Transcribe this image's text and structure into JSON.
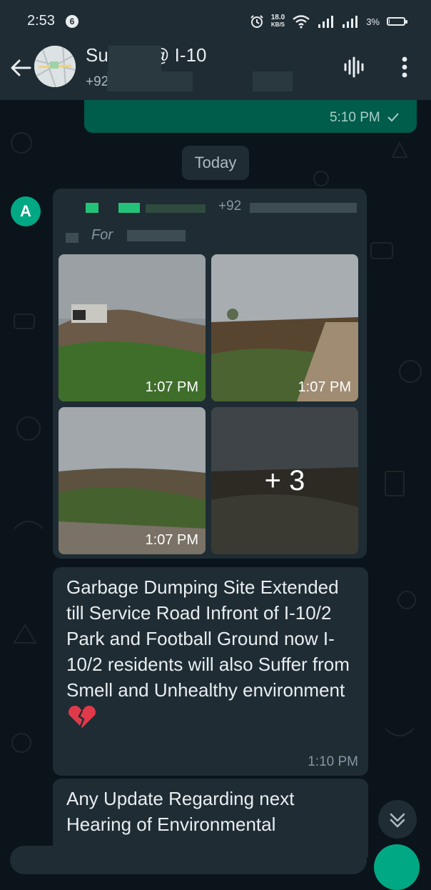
{
  "status_bar": {
    "time": "2:53",
    "notification_count": "6",
    "net_speed_value": "18.0",
    "net_speed_unit": "KB/S",
    "battery_percent": "3%",
    "battery_level": 0.03,
    "icons": [
      "alarm-icon",
      "wifi-icon",
      "signal-icon",
      "signal-icon",
      "battery-icon"
    ]
  },
  "header": {
    "title": "Support@ I-10",
    "subtitle": "+92 4951, +9",
    "icons": [
      "back-arrow-icon",
      "group-avatar",
      "voice-wave-icon",
      "more-vert-icon"
    ]
  },
  "chat": {
    "previous_message_time": "5:10 PM",
    "date_divider": "Today",
    "sender_initial": "A",
    "sender_phone": "+92",
    "forwarded_label": "For",
    "photos": [
      {
        "time": "1:07 PM"
      },
      {
        "time": "1:07 PM"
      },
      {
        "time": "1:07 PM"
      },
      {
        "more": "+ 3"
      }
    ],
    "message1": {
      "text": "Garbage Dumping Site Extended till Service Road Infront of I-10/2 Park and Football Ground now I-10/2 residents will also Suffer from Smell and Unhealthy environment",
      "emoji": "broken-heart",
      "time": "1:10 PM"
    },
    "message2": {
      "text": "Any Update Regarding next Hearing of Environmental"
    }
  },
  "colors": {
    "background": "#0b141a",
    "bar": "#1f2c34",
    "bubble_out": "#005c4b",
    "bubble_in": "#1f2c34",
    "accent": "#00a884",
    "text_primary": "#e9edef",
    "text_secondary": "#8696a0"
  }
}
